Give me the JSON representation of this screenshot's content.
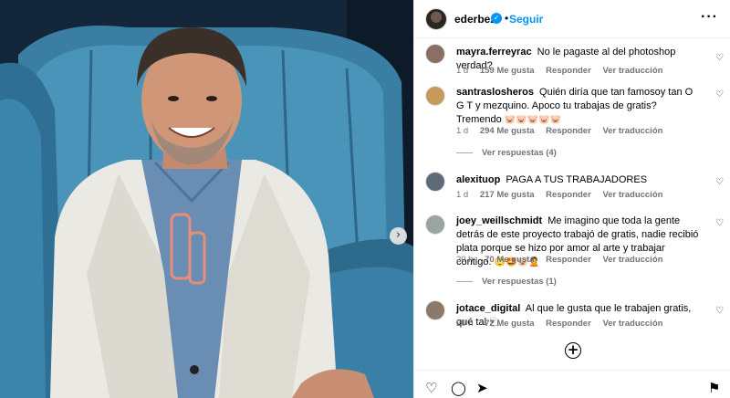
{
  "post": {
    "next_glyph": "›"
  },
  "header": {
    "username": "ederbez",
    "verified_glyph": "✓",
    "separator": "•",
    "follow_label": "Seguir",
    "more_glyph": "···"
  },
  "comments": [
    {
      "username": "mayra.ferreyrac",
      "text": "No le pagaste al del photoshop verdad?",
      "time": "1 d",
      "likes": "159 Me gusta",
      "reply_label": "Responder",
      "translate_label": "Ver traducción",
      "avatar_color": "#8a6f65"
    },
    {
      "username": "santraslosheros",
      "text": "Quién diría que tan famosoy tan O G T y mezquino. Apoco tu trabajas de gratis? Tremendo",
      "emoji": "🐷🐷🐷🐷🐷",
      "time": "1 d",
      "likes": "294 Me gusta",
      "reply_label": "Responder",
      "translate_label": "Ver traducción",
      "view_replies": "Ver respuestas (4)",
      "avatar_color": "#c79a5b"
    },
    {
      "username": "alexituop",
      "text": "PAGA A TUS TRABAJADORES",
      "time": "1 d",
      "likes": "217 Me gusta",
      "reply_label": "Responder",
      "translate_label": "Ver traducción",
      "avatar_color": "#5d6b78"
    },
    {
      "username": "joey_weillschmidt",
      "text": "Me imagino que toda la gente detrás de este proyecto trabajó de gratis, nadie recibió plata porque se hizo por amor al arte y trabajar contigo.",
      "emoji": "🙄🤩🐷🙎",
      "time": "20 h",
      "likes": "70 Me gusta",
      "reply_label": "Responder",
      "translate_label": "Ver traducción",
      "view_replies": "Ver respuestas (1)",
      "avatar_color": "#9aa5a0"
    },
    {
      "username": "jotace_digital",
      "text": "Al que le gusta que le trabajen gratis, qué tal",
      "emoji": "🐑",
      "time": "20 h",
      "likes": "72 Me gusta",
      "reply_label": "Responder",
      "translate_label": "Ver traducción",
      "avatar_color": "#8b7a6a"
    }
  ],
  "icons": {
    "heart": "♡",
    "add": "+",
    "like": "♡",
    "comment": "◯",
    "share": "➤",
    "save": "⚑"
  },
  "colors": {
    "accent": "#0095f6",
    "muted_text": "#737373",
    "chair_blue": "#3f87ad",
    "suit": "#ecebe6",
    "shirt": "#6d8fb5"
  }
}
